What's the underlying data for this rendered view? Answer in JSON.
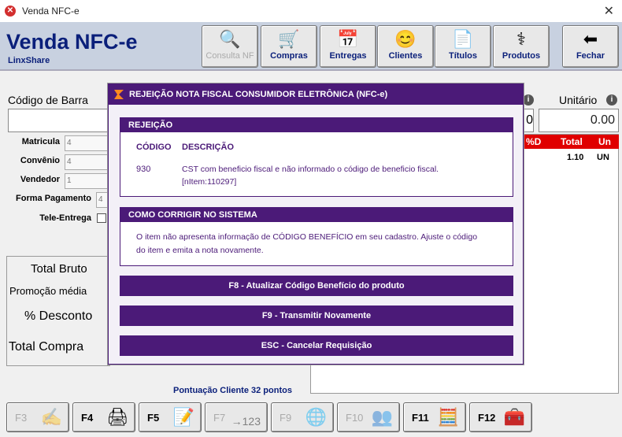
{
  "window": {
    "title": "Venda NFC-e",
    "close": "✕"
  },
  "header": {
    "title": "Venda NFC-e",
    "subtitle": "LinxShare",
    "toolbar": [
      {
        "label": "Consulta NF",
        "icon": "magnifier-icon",
        "glyph": "🔍",
        "enabled": false
      },
      {
        "label": "Compras",
        "icon": "cash-register-icon",
        "glyph": "🛒",
        "enabled": true
      },
      {
        "label": "Entregas",
        "icon": "schedule-icon",
        "glyph": "📅",
        "enabled": true
      },
      {
        "label": "Clientes",
        "icon": "smiley-icon",
        "glyph": "😊",
        "enabled": true
      },
      {
        "label": "Títulos",
        "icon": "document-icon",
        "glyph": "📄",
        "enabled": true
      },
      {
        "label": "Produtos",
        "icon": "medical-caduceus-icon",
        "glyph": "⚕",
        "enabled": true
      },
      {
        "label": "Fechar",
        "icon": "exit-arrow-icon",
        "glyph": "⬅",
        "enabled": true
      }
    ]
  },
  "form": {
    "codigo_barra_label": "Código de Barra",
    "matricula_label": "Matricula",
    "matricula_value": "4",
    "convenio_label": "Convênio",
    "convenio_value": "4",
    "vendedor_label": "Vendedor",
    "vendedor_value": "1",
    "forma_pagamento_label": "Forma Pagamento",
    "forma_pagamento_value": "4",
    "tele_entrega_label": "Tele-Entrega"
  },
  "totals": {
    "total_bruto": "Total Bruto",
    "promocao_media": "Promoção média",
    "desconto": "% Desconto",
    "total_compra": "Total Compra"
  },
  "right": {
    "unitario_label": "Unitário",
    "unitario_value": "0.00",
    "qtd_value": "0",
    "info": "i",
    "grid_headers": [
      "%D",
      "Total",
      "Un"
    ],
    "grid_rows": [
      {
        "total": "1.10",
        "un": "UN"
      }
    ]
  },
  "pontuacao": "Pontuação Cliente 32 pontos",
  "footer": [
    {
      "key": "F3",
      "icon": "pen-signature-icon",
      "glyph": "✍",
      "enabled": false
    },
    {
      "key": "F4",
      "icon": "printer-icon",
      "glyph": "🖨",
      "enabled": true
    },
    {
      "key": "F5",
      "icon": "person-note-icon",
      "glyph": "📝",
      "enabled": true
    },
    {
      "key": "F7",
      "icon": "counter-123-icon",
      "glyph": "→123",
      "enabled": false
    },
    {
      "key": "F9",
      "icon": "globe-icon",
      "glyph": "🌐",
      "enabled": false
    },
    {
      "key": "F10",
      "icon": "people-icon",
      "glyph": "👥",
      "enabled": false
    },
    {
      "key": "F11",
      "icon": "calculator-icon",
      "glyph": "🧮",
      "enabled": true
    },
    {
      "key": "F12",
      "icon": "first-aid-kit-icon",
      "glyph": "🧰",
      "enabled": true
    }
  ],
  "modal": {
    "title": "REJEIÇÃO NOTA FISCAL CONSUMIDOR ELETRÔNICA (NFC-e)",
    "rejeicao": {
      "header": "REJEIÇÃO",
      "col_codigo": "CÓDIGO",
      "col_descricao": "DESCRIÇÃO",
      "codigo": "930",
      "descricao_line1": "CST com beneficio fiscal e não informado o código de beneficio fiscal.",
      "descricao_line2": "[nItem:110297]"
    },
    "corrigir": {
      "header": "COMO CORRIGIR NO SISTEMA",
      "line1": "O item não apresenta informação de CÓDIGO BENEFÍCIO em seu cadastro. Ajuste o código",
      "line2": "do item e emita a nota novamente."
    },
    "buttons": {
      "f8": "F8 - Atualizar Código Benefício do produto",
      "f9": "F9 - Transmitir Novamente",
      "esc": "ESC - Cancelar Requisição"
    }
  }
}
